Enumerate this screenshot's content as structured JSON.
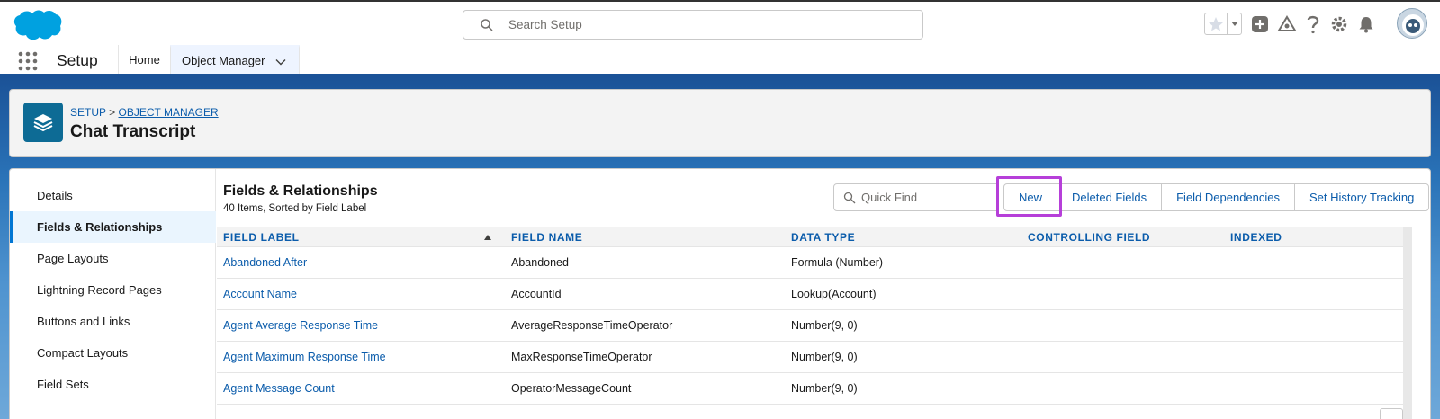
{
  "header": {
    "search_placeholder": "Search Setup",
    "brand_color": "#00a1e0"
  },
  "nav": {
    "app_name": "Setup",
    "tabs": [
      {
        "label": "Home"
      },
      {
        "label": "Object Manager"
      }
    ]
  },
  "page": {
    "breadcrumb_root": "SETUP",
    "breadcrumb_separator": ">",
    "breadcrumb_link": "OBJECT MANAGER",
    "title": "Chat Transcript"
  },
  "sidebar": {
    "items": [
      {
        "label": "Details"
      },
      {
        "label": "Fields & Relationships"
      },
      {
        "label": "Page Layouts"
      },
      {
        "label": "Lightning Record Pages"
      },
      {
        "label": "Buttons and Links"
      },
      {
        "label": "Compact Layouts"
      },
      {
        "label": "Field Sets"
      }
    ]
  },
  "section": {
    "title": "Fields & Relationships",
    "subtitle": "40 Items, Sorted by Field Label",
    "quick_find_placeholder": "Quick Find",
    "buttons": {
      "new": "New",
      "deleted_fields": "Deleted Fields",
      "field_dependencies": "Field Dependencies",
      "set_history_tracking": "Set History Tracking"
    }
  },
  "table": {
    "columns": [
      "FIELD LABEL",
      "FIELD NAME",
      "DATA TYPE",
      "CONTROLLING FIELD",
      "INDEXED"
    ],
    "rows": [
      {
        "label": "Abandoned After",
        "name": "Abandoned",
        "type": "Formula (Number)",
        "controlling": "",
        "indexed": ""
      },
      {
        "label": "Account Name",
        "name": "AccountId",
        "type": "Lookup(Account)",
        "controlling": "",
        "indexed": ""
      },
      {
        "label": "Agent Average Response Time",
        "name": "AverageResponseTimeOperator",
        "type": "Number(9, 0)",
        "controlling": "",
        "indexed": ""
      },
      {
        "label": "Agent Maximum Response Time",
        "name": "MaxResponseTimeOperator",
        "type": "Number(9, 0)",
        "controlling": "",
        "indexed": ""
      },
      {
        "label": "Agent Message Count",
        "name": "OperatorMessageCount",
        "type": "Number(9, 0)",
        "controlling": "",
        "indexed": ""
      }
    ]
  }
}
